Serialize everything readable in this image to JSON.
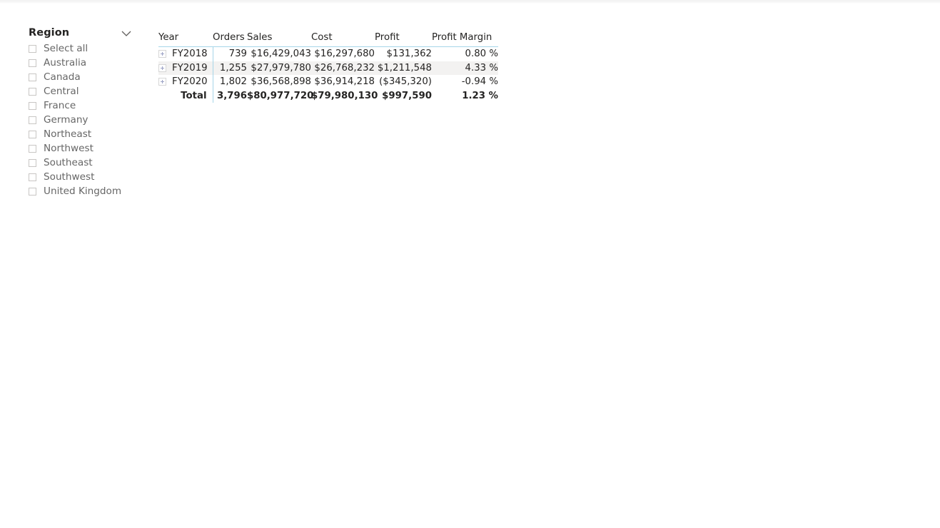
{
  "slicer": {
    "title": "Region",
    "chevron_icon": "chevron-down-icon",
    "items": [
      {
        "label": "Select all",
        "checked": false
      },
      {
        "label": "Australia",
        "checked": false
      },
      {
        "label": "Canada",
        "checked": false
      },
      {
        "label": "Central",
        "checked": false
      },
      {
        "label": "France",
        "checked": false
      },
      {
        "label": "Germany",
        "checked": false
      },
      {
        "label": "Northeast",
        "checked": false
      },
      {
        "label": "Northwest",
        "checked": false
      },
      {
        "label": "Southeast",
        "checked": false
      },
      {
        "label": "Southwest",
        "checked": false
      },
      {
        "label": "United Kingdom",
        "checked": false
      }
    ]
  },
  "matrix": {
    "columns": [
      "Year",
      "Orders",
      "Sales",
      "Cost",
      "Profit",
      "Profit Margin"
    ],
    "rows": [
      {
        "expand_icon": "expand-plus-icon",
        "year": "FY2018",
        "orders": "739",
        "sales": "$16,429,043",
        "cost": "$16,297,680",
        "profit": "$131,362",
        "profit_margin": "0.80 %"
      },
      {
        "expand_icon": "expand-plus-icon",
        "year": "FY2019",
        "orders": "1,255",
        "sales": "$27,979,780",
        "cost": "$26,768,232",
        "profit": "$1,211,548",
        "profit_margin": "4.33 %"
      },
      {
        "expand_icon": "expand-plus-icon",
        "year": "FY2020",
        "orders": "1,802",
        "sales": "$36,568,898",
        "cost": "$36,914,218",
        "profit": "($345,320)",
        "profit_margin": "-0.94 %"
      }
    ],
    "total": {
      "year": "Total",
      "orders": "3,796",
      "sales": "$80,977,720",
      "cost": "$79,980,130",
      "profit": "$997,590",
      "profit_margin": "1.23 %"
    }
  },
  "colors": {
    "grid_line": "#a6d5e8",
    "alt_row": "#f3f2f1",
    "text": "#252423",
    "slicer_label": "#666666",
    "checkbox_border": "#c8c6c4"
  }
}
